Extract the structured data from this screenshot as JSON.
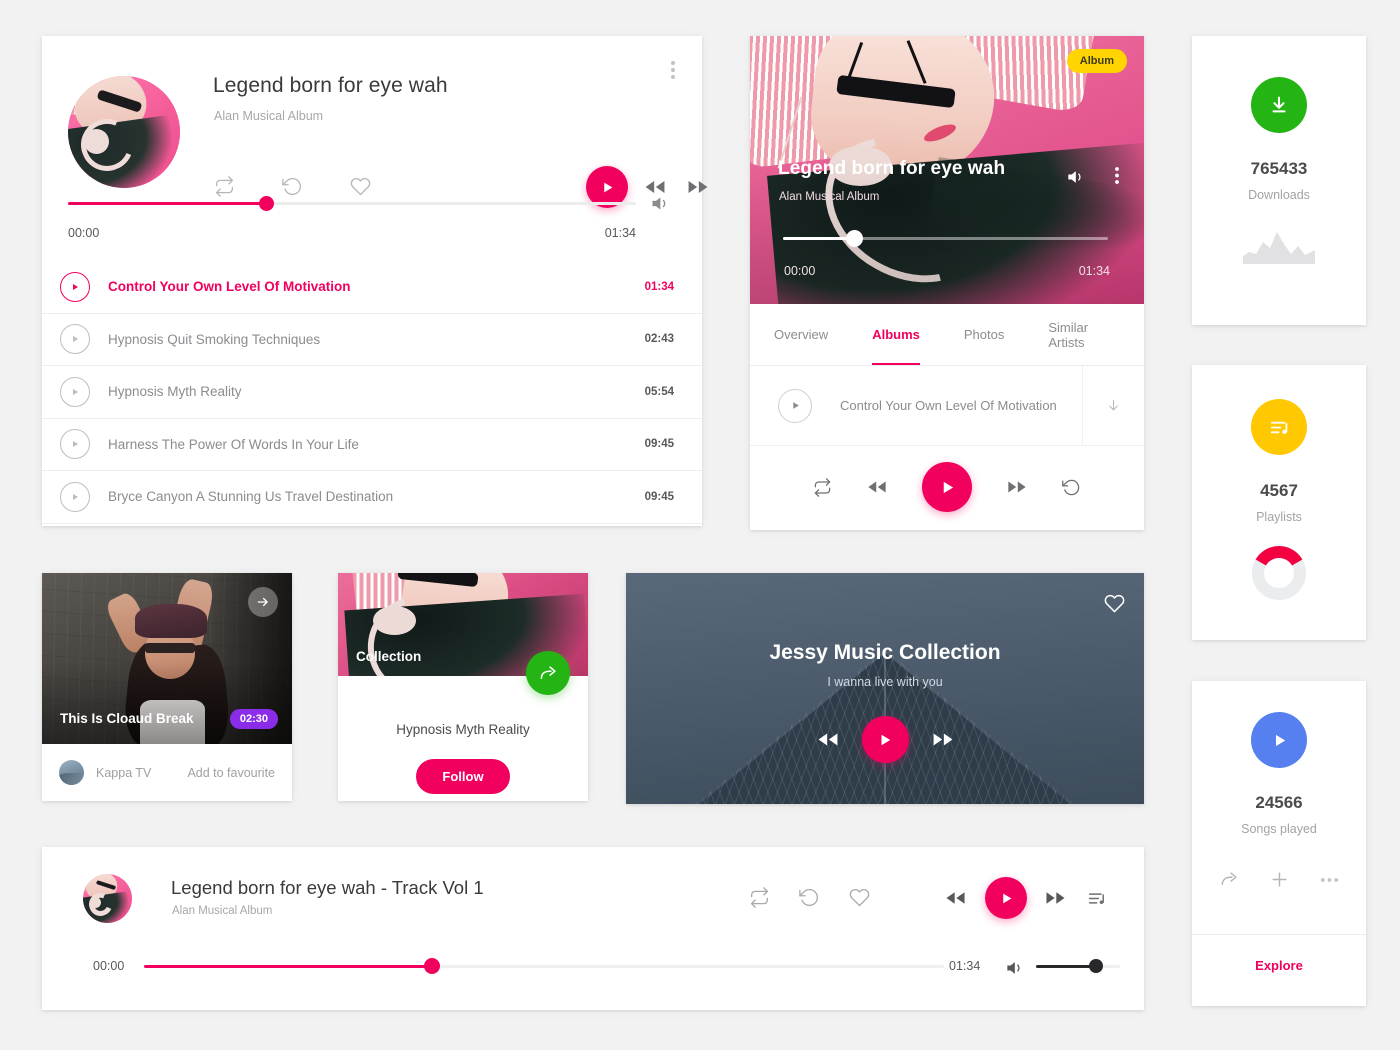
{
  "theme": {
    "accent_pink": "#f2005e",
    "green": "#24b514",
    "yellow": "#ffd400",
    "purple": "#8b2de8",
    "blue": "#5680f0",
    "page_bg": "#f2f2f2"
  },
  "player": {
    "title": "Legend born for eye wah",
    "subtitle": "Alan Musical Album",
    "icons": [
      "repeat-icon",
      "replay-icon",
      "heart-icon"
    ],
    "transport": [
      "play-icon",
      "rewind-icon",
      "fast-forward-icon"
    ],
    "menu_icon": "more-vertical-icon",
    "volume_icon": "volume-icon",
    "time_elapsed": "00:00",
    "time_total": "01:34",
    "progress_percent": 35,
    "tracks": [
      {
        "name": "Control Your Own Level Of Motivation",
        "time": "01:34",
        "active": true
      },
      {
        "name": "Hypnosis Quit Smoking Techniques",
        "time": "02:43",
        "active": false
      },
      {
        "name": "Hypnosis Myth Reality",
        "time": "05:54",
        "active": false
      },
      {
        "name": "Harness The Power Of Words In Your Life",
        "time": "09:45",
        "active": false
      },
      {
        "name": "Bryce Canyon A Stunning Us Travel Destination",
        "time": "09:45",
        "active": false
      }
    ]
  },
  "album": {
    "badge": "Album",
    "title": "Legend born for eye wah",
    "subtitle": "Alan Musical Album",
    "volume_icon": "volume-icon",
    "menu_icon": "more-vertical-icon",
    "time_elapsed": "00:00",
    "time_total": "01:34",
    "progress_percent": 22,
    "tabs": [
      {
        "label": "Overview",
        "active": false
      },
      {
        "label": "Albums",
        "active": true
      },
      {
        "label": "Photos",
        "active": false
      },
      {
        "label": "Similar Artists",
        "active": false
      }
    ],
    "track": {
      "name": "Control Your Own Level Of Motivation",
      "download_icon": "download-arrow-icon"
    },
    "controls": [
      "repeat-icon",
      "rewind-icon",
      "play-icon",
      "fast-forward-icon",
      "replay-icon"
    ]
  },
  "stats": [
    {
      "icon": "download-icon",
      "value": "765433",
      "label": "Downloads",
      "color": "#24b514",
      "viz": "sparkline"
    },
    {
      "icon": "playlist-music-icon",
      "value": "4567",
      "label": "Playlists",
      "color": "#ffc800",
      "viz": "donut"
    },
    {
      "icon": "play-icon",
      "value": "24566",
      "label": "Songs played",
      "color": "#5680f0",
      "viz": "actions"
    }
  ],
  "stats_footer": {
    "actions": [
      "share-icon",
      "plus-icon",
      "more-horizontal-icon"
    ],
    "explore_label": "Explore"
  },
  "cloaud_card": {
    "title": "This Is Cloaud Break",
    "duration_badge": "02:30",
    "arrow_icon": "arrow-right-icon",
    "channel": "Kappa TV",
    "favourite_label": "Add to favourite"
  },
  "collection_card": {
    "overlay_label": "Collection",
    "share_icon": "share-icon",
    "name": "Hypnosis Myth Reality",
    "follow_label": "Follow"
  },
  "jessy_card": {
    "heart_icon": "heart-icon",
    "title": "Jessy Music Collection",
    "subtitle": "I wanna live with you",
    "controls": [
      "rewind-icon",
      "play-icon",
      "fast-forward-icon"
    ]
  },
  "bottom_bar": {
    "title": "Legend born for eye wah - Track Vol  1",
    "subtitle": "Alan Musical Album",
    "left_icons": [
      "repeat-icon",
      "replay-icon",
      "heart-icon"
    ],
    "transport": [
      "rewind-icon",
      "play-icon",
      "fast-forward-icon",
      "queue-music-icon"
    ],
    "time_elapsed": "00:00",
    "time_total": "01:34",
    "progress_percent": 36,
    "volume_icon": "volume-icon",
    "volume_percent": 72
  }
}
